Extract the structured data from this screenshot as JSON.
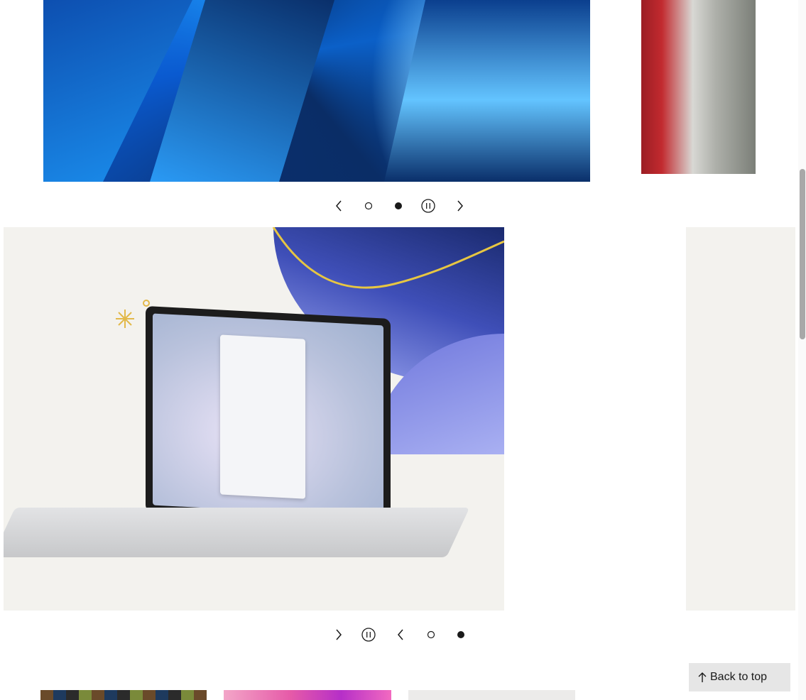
{
  "carousel_top": {
    "controls": [
      {
        "name": "previous-slide-button",
        "icon": "chevron-left-icon"
      },
      {
        "name": "slide-indicator-1",
        "icon": "dot-outline-icon",
        "active": false
      },
      {
        "name": "slide-indicator-2",
        "icon": "dot-filled-icon",
        "active": true
      },
      {
        "name": "pause-button",
        "icon": "pause-icon"
      },
      {
        "name": "next-slide-button",
        "icon": "chevron-right-icon"
      }
    ]
  },
  "carousel_bottom": {
    "controls": [
      {
        "name": "next-slide-button",
        "icon": "chevron-right-icon"
      },
      {
        "name": "pause-button",
        "icon": "pause-icon"
      },
      {
        "name": "previous-slide-button",
        "icon": "chevron-left-icon"
      },
      {
        "name": "slide-indicator-1",
        "icon": "dot-outline-icon",
        "active": false
      },
      {
        "name": "slide-indicator-2",
        "icon": "dot-filled-icon",
        "active": true
      }
    ]
  },
  "back_to_top": {
    "label": "Back to top",
    "icon": "arrow-up-icon"
  },
  "colors": {
    "accent": "#1a1a1a",
    "button_bg": "#e6e6e6",
    "slide_bg": "#f3f2ee"
  }
}
